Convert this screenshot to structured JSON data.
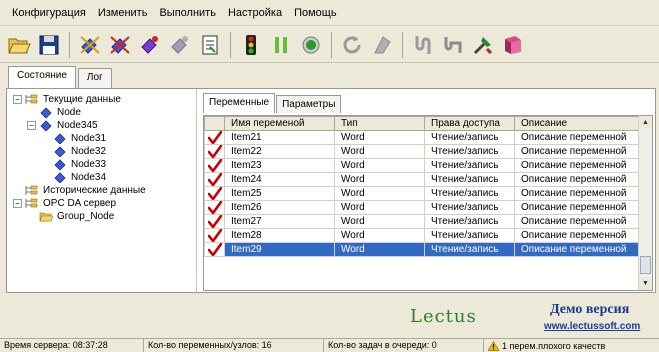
{
  "menu": [
    "Конфигурация",
    "Изменить",
    "Выполнить",
    "Настройка",
    "Помощь"
  ],
  "toolbar": {
    "icons": [
      "open-folder-icon",
      "save-disk-icon",
      "node-blue-icon",
      "node-red-icon",
      "node-purple-icon",
      "node-gray-icon",
      "document-icon",
      "traffic-light-icon",
      "pause-icon",
      "record-icon",
      "refresh-icon",
      "erase-icon",
      "pipe-icon",
      "pipe-gray-icon",
      "tools-icon",
      "book-icon"
    ]
  },
  "outer_tabs": [
    "Состояние",
    "Лог"
  ],
  "tree": {
    "nodes": [
      {
        "label": "Текущие данные",
        "level": 0,
        "expander": "−",
        "icon": "folder-tree-icon"
      },
      {
        "label": "Node",
        "level": 1,
        "expander": "",
        "icon": "node-icon"
      },
      {
        "label": "Node345",
        "level": 1,
        "expander": "−",
        "icon": "node-icon"
      },
      {
        "label": "Node31",
        "level": 2,
        "expander": "",
        "icon": "node-icon"
      },
      {
        "label": "Node32",
        "level": 2,
        "expander": "",
        "icon": "node-icon"
      },
      {
        "label": "Node33",
        "level": 2,
        "expander": "",
        "icon": "node-icon"
      },
      {
        "label": "Node34",
        "level": 2,
        "expander": "",
        "icon": "node-icon"
      },
      {
        "label": "Исторические данные",
        "level": 0,
        "expander": "",
        "icon": "folder-tree-icon"
      },
      {
        "label": "OPC DA сервер",
        "level": 0,
        "expander": "−",
        "icon": "folder-tree-icon"
      },
      {
        "label": "Group_Node",
        "level": 1,
        "expander": "",
        "icon": "open-folder-icon"
      }
    ]
  },
  "inner_tabs": [
    "Переменные",
    "Параметры"
  ],
  "table": {
    "headers": [
      "",
      "Имя переменой",
      "Тип",
      "Права доступа",
      "Описание"
    ],
    "rows": [
      {
        "name": "Item21",
        "type": "Word",
        "access": "Чтение/запись",
        "desc": "Описание переменной"
      },
      {
        "name": "Item22",
        "type": "Word",
        "access": "Чтение/запись",
        "desc": "Описание переменной"
      },
      {
        "name": "Item23",
        "type": "Word",
        "access": "Чтение/запись",
        "desc": "Описание переменной"
      },
      {
        "name": "Item24",
        "type": "Word",
        "access": "Чтение/запись",
        "desc": "Описание переменной"
      },
      {
        "name": "Item25",
        "type": "Word",
        "access": "Чтение/запись",
        "desc": "Описание переменной"
      },
      {
        "name": "Item26",
        "type": "Word",
        "access": "Чтение/запись",
        "desc": "Описание переменной"
      },
      {
        "name": "Item27",
        "type": "Word",
        "access": "Чтение/запись",
        "desc": "Описание переменной"
      },
      {
        "name": "Item28",
        "type": "Word",
        "access": "Чтение/запись",
        "desc": "Описание переменной"
      },
      {
        "name": "Item29",
        "type": "Word",
        "access": "Чтение/запись",
        "desc": "Описание переменной"
      }
    ],
    "selected_row": "Item29"
  },
  "banner": {
    "logo": "Lectus",
    "demo": "Демо версия",
    "link": "www.lectussoft.com"
  },
  "status": {
    "server_time": "Время сервера: 08:37:28",
    "vars_nodes": "Кол-во переменных/узлов: 16",
    "queue": "Кол-во задач в очереди: 0",
    "bad_quality": "1 перем.плохого качеств"
  },
  "colors": {
    "selection": "#316ac5",
    "check": "#cc0000",
    "demo": "#1a3a8f"
  }
}
